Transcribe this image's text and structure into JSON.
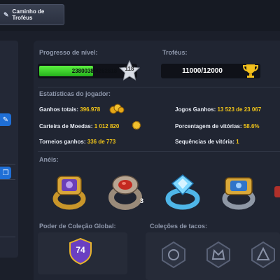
{
  "header": {
    "tab_label": "Caminho de Troféus",
    "tab_icon": "pencil-icon"
  },
  "level": {
    "label": "Progresso de nível:",
    "xp_text": "2380038/4262818",
    "xp_fraction": 0.558,
    "level_number": "118",
    "bar_color": "#3fd12a"
  },
  "trophies": {
    "label": "Troféus:",
    "value": "11000/12000"
  },
  "stats": {
    "label": "Estatísticas do jogador:",
    "earnings_label": "Ganhos totais:",
    "earnings_value": "396.978",
    "wallet_label": "Carteira de Moedas:",
    "wallet_value": "1 012 820",
    "tournaments_label": "Torneios ganhos:",
    "tournaments_value": "336 de 773",
    "games_won_label": "Jogos Ganhos:",
    "games_won_value": "13 523 de 23 067",
    "win_pct_label": "Porcentagem de vitórias:",
    "win_pct_value": "58.6%",
    "streak_label": "Sequências de vitória:",
    "streak_value": "1"
  },
  "rings": {
    "label": "Anéis:",
    "items": [
      {
        "name": "purple-gem-ring",
        "count": ""
      },
      {
        "name": "red-gem-ring",
        "count": "3"
      },
      {
        "name": "blue-gem-ring",
        "count": ""
      },
      {
        "name": "blue-gold-ring",
        "count": ""
      }
    ]
  },
  "collection": {
    "label": "Poder de Coleção Global:",
    "power": "74"
  },
  "cues": {
    "label": "Coleções de tacos:"
  },
  "colors": {
    "accent_gold": "#f0c419",
    "accent_blue": "#1f6fd6"
  }
}
